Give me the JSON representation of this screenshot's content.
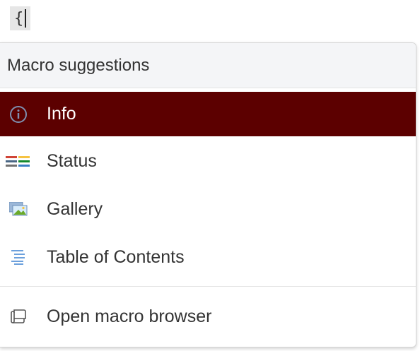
{
  "editor": {
    "typed_text": "{"
  },
  "popup": {
    "header": "Macro suggestions",
    "items": [
      {
        "label": "Info",
        "icon": "info-icon",
        "selected": true
      },
      {
        "label": "Status",
        "icon": "status-icon",
        "selected": false
      },
      {
        "label": "Gallery",
        "icon": "gallery-icon",
        "selected": false
      },
      {
        "label": "Table of Contents",
        "icon": "table-of-contents-icon",
        "selected": false
      }
    ],
    "footer": {
      "label": "Open macro browser",
      "icon": "macro-browser-icon"
    }
  },
  "colors": {
    "selected_background": "#5c0000",
    "selected_text": "#ffffff",
    "header_background": "#f4f5f7"
  }
}
